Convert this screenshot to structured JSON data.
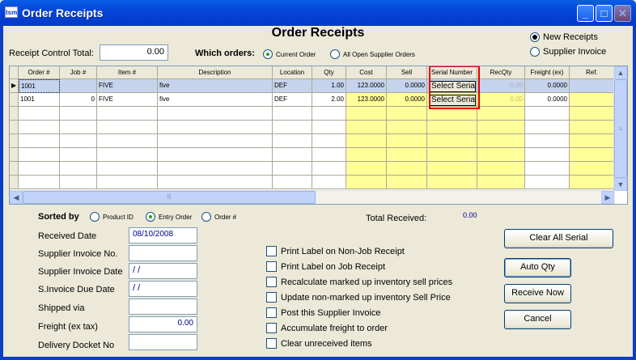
{
  "window": {
    "title": "Order Receipts",
    "icon_text": "tsm"
  },
  "heading": "Order Receipts",
  "receipt_type": {
    "options": [
      {
        "label": "New Receipts",
        "selected": true
      },
      {
        "label": "Supplier Invoice",
        "selected": false
      }
    ]
  },
  "receipt_control": {
    "label": "Receipt Control Total:",
    "value": "0.00"
  },
  "which_orders": {
    "label": "Which orders:",
    "options": [
      {
        "label": "Current Order",
        "selected": true
      },
      {
        "label": "All  Open Supplier Orders",
        "selected": false
      }
    ]
  },
  "grid": {
    "columns": [
      "Order #",
      "Job #",
      "Item #",
      "Description",
      "Location",
      "Qty",
      "Cost",
      "Sell",
      "Serial Number",
      "RecQty",
      "Freight (ex)",
      "Ref."
    ],
    "rows": [
      {
        "order": "1001",
        "job": "",
        "item": "FIVE",
        "description": "five",
        "location": "DEF",
        "qty": "1.00",
        "cost": "123.0000",
        "sell": "0.0000",
        "serial": "Select Serial",
        "recqty": "0.00",
        "freight": "0.0000",
        "ref": ""
      },
      {
        "order": "1001",
        "job": "0",
        "item": "FIVE",
        "description": "five",
        "location": "DEF",
        "qty": "2.00",
        "cost": "123.0000",
        "sell": "0.0000",
        "serial": "Select Serial",
        "recqty": "0.00",
        "freight": "0.0000",
        "ref": ""
      }
    ],
    "hscroll_thumb": "lll"
  },
  "sorted_by": {
    "label": "Sorted by",
    "options": [
      {
        "label": "Product ID",
        "selected": false
      },
      {
        "label": "Entry Order",
        "selected": true
      },
      {
        "label": "Order #",
        "selected": false
      }
    ]
  },
  "total_received": {
    "label": "Total Received:",
    "value": "0.00"
  },
  "fields": [
    {
      "label": "Received Date",
      "value": "08/10/2008"
    },
    {
      "label": "Supplier Invoice No.",
      "value": ""
    },
    {
      "label": "Supplier Invoice Date",
      "value": " /  /"
    },
    {
      "label": "S.Invoice Due Date",
      "value": " /  /"
    },
    {
      "label": "Shipped via",
      "value": ""
    },
    {
      "label": "Freight (ex tax)",
      "value": "0.00"
    },
    {
      "label": "Delivery Docket No",
      "value": ""
    }
  ],
  "checkboxes": [
    "Print Label on Non-Job Receipt",
    "Print Label on Job Receipt",
    "Recalculate marked up inventory sell prices",
    "Update non-marked up inventory Sell Price",
    "Post this Supplier Invoice",
    "Accumulate freight to order",
    "Clear unreceived items"
  ],
  "buttons": {
    "clear_all_serial": "Clear All Serial",
    "auto_qty": "Auto Qty",
    "receive_now": "Receive Now",
    "cancel": "Cancel"
  }
}
